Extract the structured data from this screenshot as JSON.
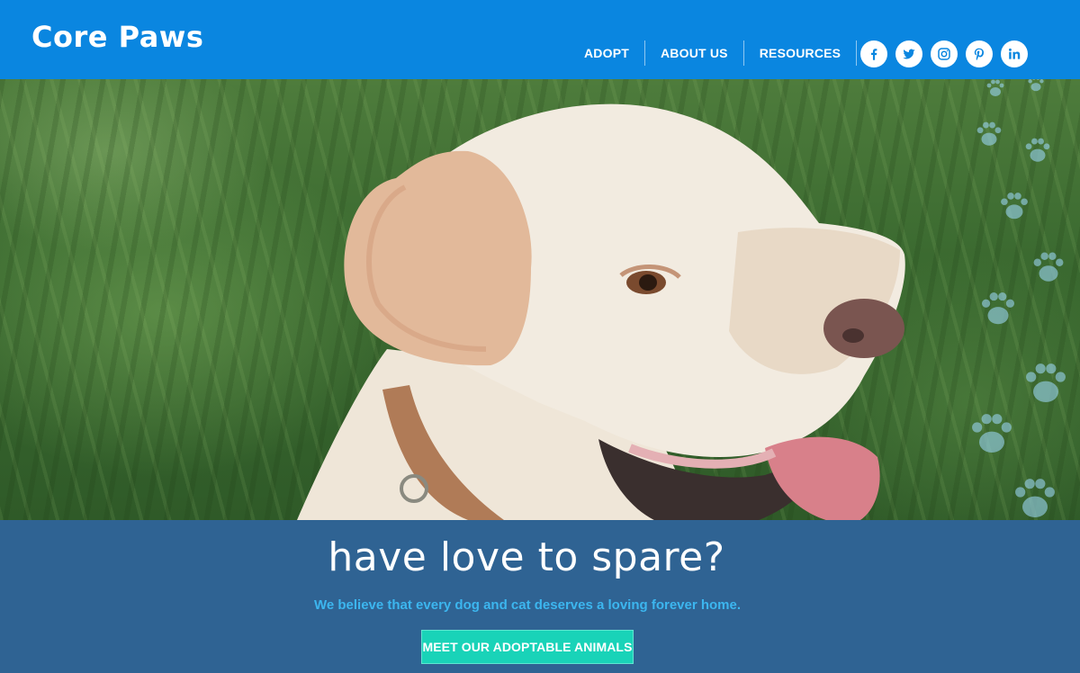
{
  "brand": {
    "name": "Core Paws"
  },
  "nav": {
    "items": [
      {
        "label": "ADOPT"
      },
      {
        "label": "ABOUT US"
      },
      {
        "label": "RESOURCES"
      }
    ]
  },
  "socials": [
    {
      "icon": "facebook-icon"
    },
    {
      "icon": "twitter-icon"
    },
    {
      "icon": "instagram-icon"
    },
    {
      "icon": "pinterest-icon"
    },
    {
      "icon": "linkedin-icon"
    }
  ],
  "hero": {
    "image": "dog-photo",
    "decoration": "paw-prints-trail"
  },
  "band": {
    "headline": "have love to spare?",
    "tagline": "We believe that every dog and cat deserves a loving forever home.",
    "cta_label": "MEET OUR ADOPTABLE ANIMALS"
  },
  "colors": {
    "header": "#0a86e0",
    "band": "#2f6393",
    "tagline": "#3cb6ef",
    "cta": "#19d3b8",
    "paw": "#9ad4f0"
  }
}
